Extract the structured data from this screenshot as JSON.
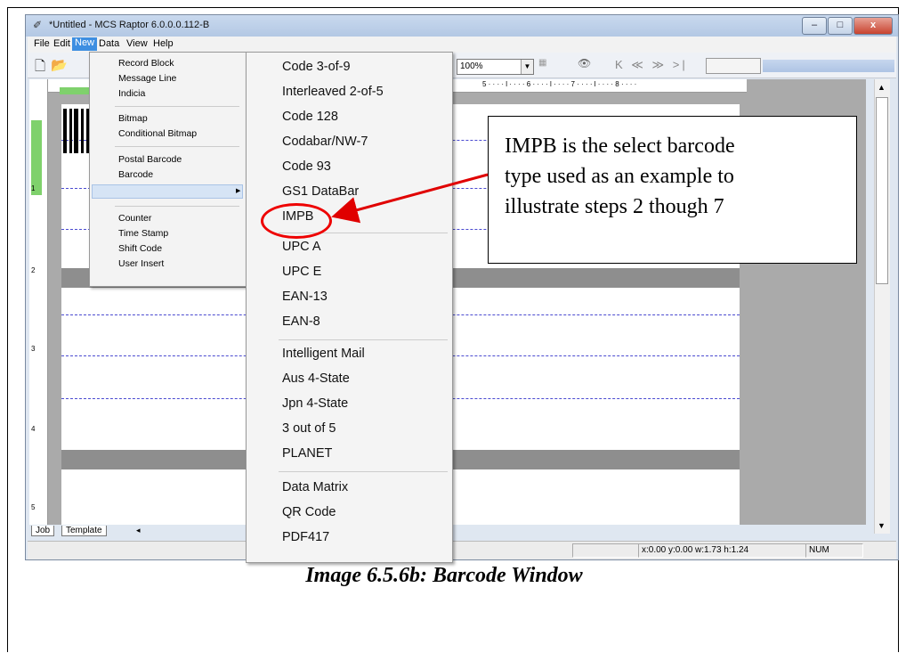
{
  "window": {
    "title": "*Untitled - MCS Raptor 6.0.0.0.112-B",
    "controls": [
      "–",
      "□",
      "x"
    ]
  },
  "menubar": [
    "File",
    "Edit",
    "New",
    "Data",
    "View",
    "Help"
  ],
  "toolbar": {
    "zoom": "100%",
    "nav": "K ≪ ≫ >|"
  },
  "ruler": {
    "horizontal": "5 · · · · l · · · · 6 · · · · l · · · · 7 · · · · l · · · · 8 · · · ·",
    "vertical": [
      "1",
      "2",
      "3",
      "4",
      "5"
    ]
  },
  "new_menu": [
    "Record Block",
    "Message Line",
    "Indicia",
    "Bitmap",
    "Conditional Bitmap",
    "Postal Barcode",
    "Barcode",
    "Counter",
    "Time Stamp",
    "Shift Code",
    "User Insert"
  ],
  "barcode_menu": [
    "Code 3-of-9",
    "Interleaved 2-of-5",
    "Code 128",
    "Codabar/NW-7",
    "Code 93",
    "GS1 DataBar",
    "IMPB",
    "UPC A",
    "UPC E",
    "EAN-13",
    "EAN-8",
    "Intelligent Mail",
    "Aus 4-State",
    "Jpn 4-State",
    "3 out of 5",
    "PLANET",
    "Data Matrix",
    "QR Code",
    "PDF417"
  ],
  "sheet_tabs": [
    "Job",
    "Template"
  ],
  "status": {
    "coords": "x:0.00 y:0.00 w:1.73 h:1.24",
    "mode": "NUM"
  },
  "callout": {
    "lines": [
      "IMPB is the select barcode",
      "type used as an example to",
      "illustrate steps 2 though 7"
    ]
  },
  "caption": "Image 6.5.6b: Barcode Window",
  "colors": {
    "highlight_circle": "#e00000",
    "menu_active": "#3d8ee1",
    "ruler_marker": "#7fd16c"
  }
}
